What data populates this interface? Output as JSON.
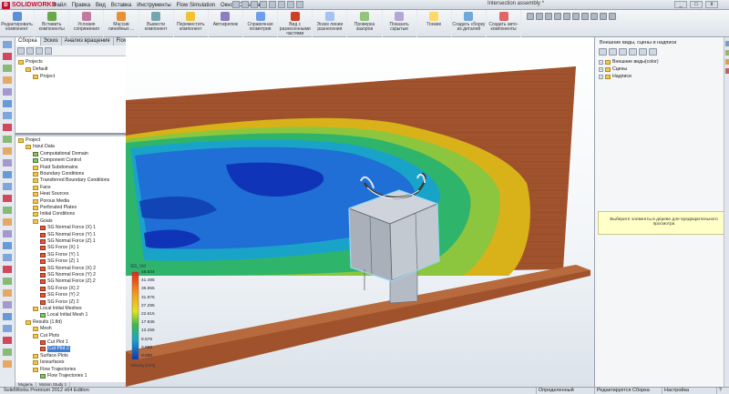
{
  "app": {
    "logo": "SOLIDWORKS",
    "menu": [
      "Файл",
      "Правка",
      "Вид",
      "Вставка",
      "Инструменты",
      "Flow Simulation",
      "Окно",
      "Справка"
    ],
    "document_title": "Intersection assembly *",
    "window_controls": [
      "_",
      "□",
      "x"
    ]
  },
  "ribbon": {
    "items": [
      {
        "label": "Редактировать компонент",
        "icon": "edit-component-icon",
        "color": "#5b8fd6"
      },
      {
        "label": "Вставить компоненты",
        "icon": "insert-components-icon",
        "color": "#6aa84f"
      },
      {
        "label": "Условия сопряжения",
        "icon": "mate-icon",
        "color": "#c27ba0"
      },
      {
        "label": "Массив линейных ...",
        "icon": "linear-pattern-icon",
        "color": "#e69138"
      },
      {
        "label": "Вывести компонент",
        "icon": "show-component-icon",
        "color": "#76a5af"
      },
      {
        "label": "Переместить компонент",
        "icon": "move-component-icon",
        "color": "#f1c232"
      },
      {
        "label": "Автокрепеж",
        "icon": "smart-fasteners-icon",
        "color": "#8e7cc3"
      },
      {
        "label": "Справочная геометрия",
        "icon": "reference-geometry-icon",
        "color": "#6d9eeb"
      },
      {
        "label": "Вид с разнесенными частями",
        "icon": "exploded-view-icon",
        "color": "#cc4125"
      },
      {
        "label": "Эскиз линии разнесения",
        "icon": "explode-line-sketch-icon",
        "color": "#a4c2f4"
      },
      {
        "label": "Проверка зазоров",
        "icon": "interference-icon",
        "color": "#93c47d"
      },
      {
        "label": "Показать скрытые",
        "icon": "show-hidden-icon",
        "color": "#b4a7d6"
      },
      {
        "label": "Тонкие",
        "icon": "thin-icon",
        "color": "#ffd966"
      },
      {
        "label": "Создать сборку из деталей",
        "icon": "assembly-icon",
        "color": "#6fa8dc"
      },
      {
        "label": "Создать авто-компоненты",
        "icon": "auto-components-icon",
        "color": "#e06666"
      }
    ]
  },
  "feature_manager": {
    "tabs": [
      "Сборка",
      "Эскиз",
      "Анализ вращения",
      "Flow Simulation"
    ],
    "top_tree": [
      {
        "label": "Projects",
        "level": 0,
        "icon": "folder"
      },
      {
        "label": "Default",
        "level": 1,
        "icon": "folder"
      },
      {
        "label": "Project",
        "level": 2,
        "icon": "folder"
      }
    ],
    "tree": [
      {
        "label": "Project",
        "level": 0,
        "icon": "folder"
      },
      {
        "label": "Input Data",
        "level": 1,
        "icon": "folder"
      },
      {
        "label": "Computational Domain",
        "level": 2,
        "icon": "green"
      },
      {
        "label": "Component Control",
        "level": 2,
        "icon": "green"
      },
      {
        "label": "Fluid Subdomains",
        "level": 2,
        "icon": "folder"
      },
      {
        "label": "Boundary Conditions",
        "level": 2,
        "icon": "folder"
      },
      {
        "label": "Transferred Boundary Conditions",
        "level": 2,
        "icon": "folder"
      },
      {
        "label": "Fans",
        "level": 2,
        "icon": "folder"
      },
      {
        "label": "Heat Sources",
        "level": 2,
        "icon": "folder"
      },
      {
        "label": "Porous Media",
        "level": 2,
        "icon": "folder"
      },
      {
        "label": "Perforated Plates",
        "level": 2,
        "icon": "folder"
      },
      {
        "label": "Initial Conditions",
        "level": 2,
        "icon": "folder"
      },
      {
        "label": "Goals",
        "level": 2,
        "icon": "folder"
      },
      {
        "label": "SG Normal Force (X) 1",
        "level": 3,
        "icon": "red"
      },
      {
        "label": "SG Normal Force (Y) 1",
        "level": 3,
        "icon": "red"
      },
      {
        "label": "SG Normal Force (Z) 1",
        "level": 3,
        "icon": "red"
      },
      {
        "label": "SG Force (X) 1",
        "level": 3,
        "icon": "red"
      },
      {
        "label": "SG Force (Y) 1",
        "level": 3,
        "icon": "red"
      },
      {
        "label": "SG Force (Z) 1",
        "level": 3,
        "icon": "red"
      },
      {
        "label": "SG Normal Force (X) 2",
        "level": 3,
        "icon": "red"
      },
      {
        "label": "SG Normal Force (Y) 2",
        "level": 3,
        "icon": "red"
      },
      {
        "label": "SG Normal Force (Z) 2",
        "level": 3,
        "icon": "red"
      },
      {
        "label": "SG Force (X) 2",
        "level": 3,
        "icon": "red"
      },
      {
        "label": "SG Force (Y) 2",
        "level": 3,
        "icon": "red"
      },
      {
        "label": "SG Force (Z) 2",
        "level": 3,
        "icon": "red"
      },
      {
        "label": "Local Initial Meshes",
        "level": 2,
        "icon": "folder"
      },
      {
        "label": "Local Initial Mesh 1",
        "level": 3,
        "icon": "green"
      },
      {
        "label": "Results (1.fld)",
        "level": 1,
        "icon": "folder"
      },
      {
        "label": "Mesh",
        "level": 2,
        "icon": "folder"
      },
      {
        "label": "Cut Plots",
        "level": 2,
        "icon": "folder"
      },
      {
        "label": "Cut Plot 1",
        "level": 3,
        "icon": "red"
      },
      {
        "label": "Cut Plot 2",
        "level": 3,
        "icon": "red",
        "selected": true
      },
      {
        "label": "Surface Plots",
        "level": 2,
        "icon": "folder"
      },
      {
        "label": "Isosurfaces",
        "level": 2,
        "icon": "folder"
      },
      {
        "label": "Flow Trajectories",
        "level": 2,
        "icon": "folder"
      },
      {
        "label": "Flow Trajectories 1",
        "level": 3,
        "icon": "green"
      }
    ],
    "bottom_tabs": [
      "Модель",
      "Motion Study 1"
    ]
  },
  "viewport": {
    "legend": {
      "title": "SG_Vel",
      "values": [
        "45.634",
        "41.495",
        "36.855",
        "31.975",
        "27.295",
        "22.615",
        "17.935",
        "13.256",
        "8.576",
        "3.896",
        "0.000"
      ],
      "unit": "Velocity [m/s]"
    }
  },
  "task_pane": {
    "title": "Внешние виды, сцены и надписи",
    "items": [
      {
        "label": "Внешние виды(color)",
        "icon": "appearance-icon"
      },
      {
        "label": "Сцены",
        "icon": "scene-icon"
      },
      {
        "label": "Надписи",
        "icon": "decal-icon"
      }
    ],
    "note": "Выберите элементы в дереве для предварительного просмотра"
  },
  "status_bar": {
    "left": "SolidWorks Premium 2012 x64 Edition",
    "cells": [
      "Определенный",
      "Редактируется Сборка",
      "Настройка",
      "?"
    ]
  },
  "colors": {
    "wall": "#a0522d",
    "accent": "#c8102e",
    "selection": "#3f7fd0"
  }
}
